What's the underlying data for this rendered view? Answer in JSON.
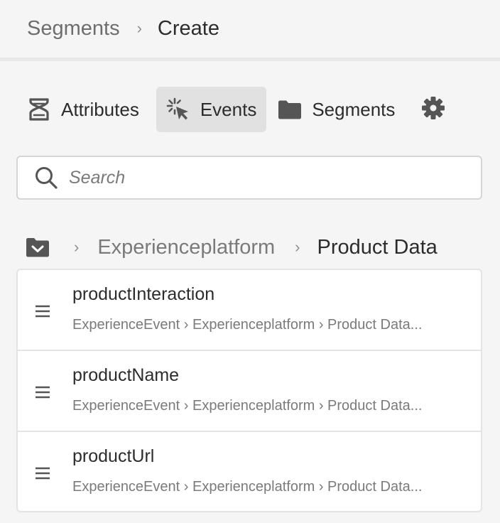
{
  "breadcrumb": {
    "parent": "Segments",
    "separator": "›",
    "current": "Create"
  },
  "tabs": [
    {
      "label": "Attributes",
      "icon": "dna-icon",
      "active": false
    },
    {
      "label": "Events",
      "icon": "cursor-click-icon",
      "active": true
    },
    {
      "label": "Segments",
      "icon": "folder-icon",
      "active": false
    }
  ],
  "settings": {
    "icon": "gear-icon"
  },
  "search": {
    "placeholder": "Search",
    "value": ""
  },
  "path": {
    "folder_icon": "folder-down-icon",
    "separator": "›",
    "items": [
      "Experienceplatform",
      "Product Data"
    ]
  },
  "items": [
    {
      "title": "productInteraction",
      "path": "ExperienceEvent › Experienceplatform › Product Data..."
    },
    {
      "title": "productName",
      "path": "ExperienceEvent › Experienceplatform › Product Data..."
    },
    {
      "title": "productUrl",
      "path": "ExperienceEvent › Experienceplatform › Product Data..."
    }
  ],
  "colors": {
    "background": "#f5f5f5",
    "active_tab": "#e1e1e1",
    "text": "#2c2c2c",
    "muted": "#7a7a7a",
    "icon": "#555555"
  }
}
